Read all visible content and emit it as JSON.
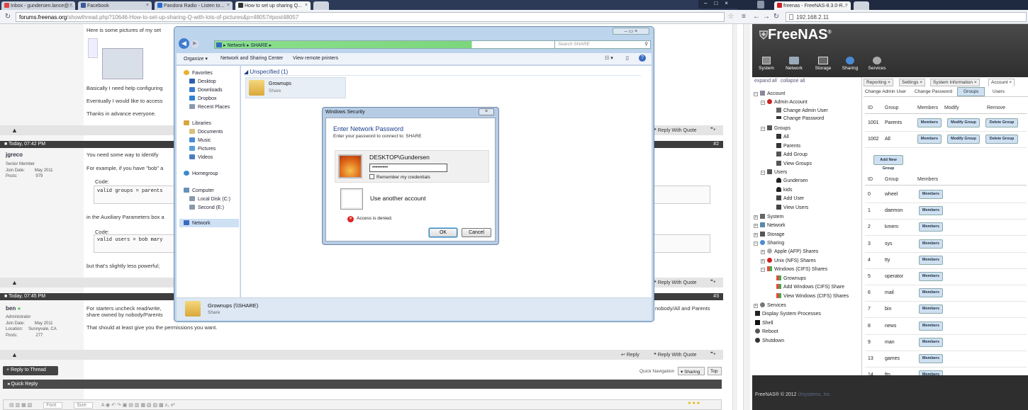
{
  "left_browser": {
    "tabs": [
      {
        "label": "Inbox - gundersen.lance@...",
        "color": "#d44"
      },
      {
        "label": "Facebook",
        "color": "#3b5998"
      },
      {
        "label": "Pandora Radio - Listen to...",
        "color": "#2a6bd1"
      },
      {
        "label": "How to set up sharing Q...",
        "color": "#333"
      }
    ],
    "url_domain": "forums.freenas.org",
    "url_path": "/showthread.php?10646-How-to-set-up-sharing-Q-with-lots-of-pictures&p=48057#post48057"
  },
  "right_browser": {
    "tab": "freenas - FreeNAS-8.3.0-R...",
    "url": "192.168.2.11"
  },
  "forum": {
    "intro": "Here is some pictures of my set",
    "p1": "Basically I need help configuring",
    "p2": "Eventually I would like to access",
    "p3": "Thanks in advance everyone.",
    "post2": {
      "date": "Today, 07:42 PM",
      "num": "#2",
      "user": "jgreco",
      "rank": "Senior Member",
      "join_label": "Join Date:",
      "join": "May 2011",
      "posts_label": "Posts:",
      "posts": "979",
      "l1": "You need some way to identify",
      "l2": "For example, if you have \"bob\" a",
      "code_label": "Code:",
      "code1": "valid groups = parents",
      "l3": "in the Auxiliary Parameters box a",
      "code2": "valid users = bob mary",
      "l4": "but that's slightly less powerful;"
    },
    "post3": {
      "date": "Today, 07:45 PM",
      "num": "#3",
      "user": "ben",
      "rank": "Administrator",
      "join_label": "Join Date:",
      "join": "May 2011",
      "location_label": "Location:",
      "location": "Sunnyvale, CA",
      "posts_label": "Posts:",
      "posts": "277",
      "l1": "For starters uncheck read/write,",
      "l1b": "share owned by nobody/Parents",
      "l1c": "nobody/All and Parents",
      "l2": "That should at least give you the permissions you want."
    },
    "reply_with_quote": "Reply With Quote",
    "reply": "Reply",
    "reply_thread": "+ Reply to Thread",
    "quick_nav": "Quick Navigation",
    "sharing": "▾ Sharing",
    "top": "Top",
    "quick_reply": "Quick Reply",
    "editor_font": "Font",
    "editor_size": "Size"
  },
  "explorer": {
    "crumb": "▸ Network ▸ SHARE ▸",
    "search_placeholder": "Search SHARE",
    "organize": "Organize ▾",
    "network_center": "Network and Sharing Center",
    "view_printers": "View remote printers",
    "favorites": "Favorites",
    "desktop": "Desktop",
    "downloads": "Downloads",
    "dropbox": "Dropbox",
    "recent": "Recent Places",
    "libraries": "Libraries",
    "documents": "Documents",
    "music": "Music",
    "pictures": "Pictures",
    "videos": "Videos",
    "homegroup": "Homegroup",
    "computer": "Computer",
    "localdisk": "Local Disk (C:)",
    "second": "Second (E:)",
    "network": "Network",
    "group_header": "Unspecified (1)",
    "folder_name": "Grownups",
    "folder_sub": "Share",
    "status_name": "Grownups (\\\\SHARE)",
    "status_sub": "Share"
  },
  "dialog": {
    "title": "Windows Security",
    "heading": "Enter Network Password",
    "sub": "Enter your password to connect to: SHARE",
    "account": "DESKTOP\\Gundersen",
    "password": "•••••••••",
    "remember": "Remember my credentials",
    "other": "Use another account",
    "error": "Access is denied.",
    "ok": "OK",
    "cancel": "Cancel"
  },
  "freenas": {
    "logo": "FreeNAS",
    "nav": [
      "System",
      "Network",
      "Storage",
      "Sharing",
      "Services"
    ],
    "expand": "expand all",
    "collapse": "collapse all",
    "tree": {
      "account": "Account",
      "admin_account": "Admin Account",
      "change_admin": "Change Admin User",
      "change_pw": "Change Password",
      "groups": "Groups",
      "all": "All",
      "parents": "Parents",
      "add_group": "Add Group",
      "view_groups": "View Groups",
      "users": "Users",
      "gundersen": "Gundersen",
      "kids": "kids",
      "add_user": "Add User",
      "view_users": "View Users",
      "system": "System",
      "network": "Network",
      "storage": "Storage",
      "sharing": "Sharing",
      "afp": "Apple (AFP) Shares",
      "nfs": "Unix (NFS) Shares",
      "cifs": "Windows (CIFS) Shares",
      "grownups": "Grownups",
      "add_cifs": "Add Windows (CIFS) Share",
      "view_cifs": "View Windows (CIFS) Shares",
      "services": "Services",
      "display": "Display System Processes",
      "shell": "Shell",
      "reboot": "Reboot",
      "shutdown": "Shutdown"
    },
    "tabs": [
      "Reporting",
      "Settings",
      "System Information",
      "Account"
    ],
    "subtabs": [
      "Change Admin User",
      "Change Password",
      "Groups",
      "Users"
    ],
    "group_cols": [
      "ID",
      "Group",
      "Members",
      "Modify",
      "Remove"
    ],
    "groups": [
      {
        "id": "1001",
        "name": "Parents"
      },
      {
        "id": "1002",
        "name": "All"
      }
    ],
    "members_btn": "Members",
    "modify_btn": "Modify Group",
    "delete_btn": "Delete Group",
    "add_group_btn": "Add New Group",
    "sys_cols": [
      "ID",
      "Group",
      "Members"
    ],
    "sys_groups": [
      {
        "id": "0",
        "name": "wheel"
      },
      {
        "id": "1",
        "name": "daemon"
      },
      {
        "id": "2",
        "name": "kmem"
      },
      {
        "id": "3",
        "name": "sys"
      },
      {
        "id": "4",
        "name": "tty"
      },
      {
        "id": "5",
        "name": "operator"
      },
      {
        "id": "6",
        "name": "mail"
      },
      {
        "id": "7",
        "name": "bin"
      },
      {
        "id": "8",
        "name": "news"
      },
      {
        "id": "9",
        "name": "man"
      },
      {
        "id": "13",
        "name": "games"
      },
      {
        "id": "14",
        "name": "ftp"
      }
    ],
    "footer": "FreeNAS® © 2012",
    "footer_link": "iXsystems, Inc."
  }
}
